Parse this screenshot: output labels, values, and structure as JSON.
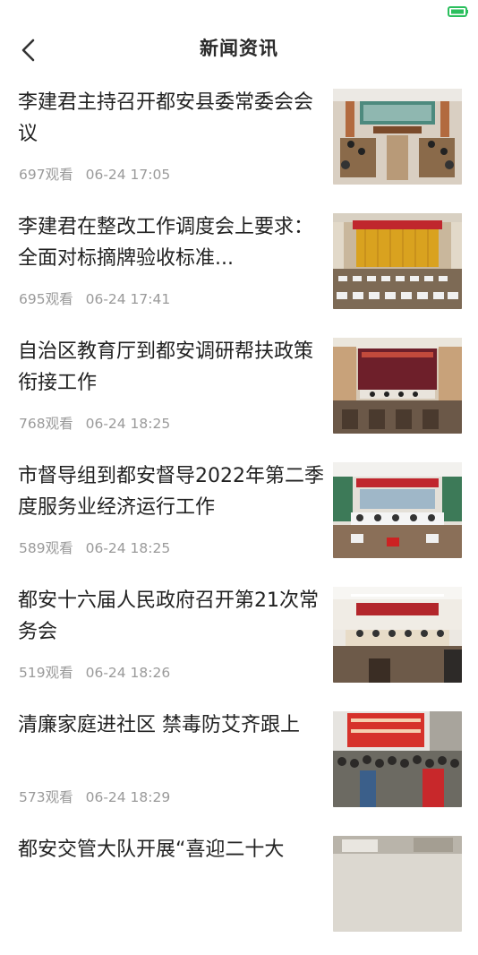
{
  "header": {
    "title": "新闻资讯"
  },
  "icons": {
    "back": "chevron-left-icon",
    "status": "battery-charging-icon"
  },
  "colors": {
    "status_accent": "#2bbf5d",
    "meta_text": "#9a9a9a"
  },
  "news": [
    {
      "title": "李建君主持召开都安县委常委会会议",
      "views": "697观看",
      "time": "06-24 17:05"
    },
    {
      "title": "李建君在整改工作调度会上要求：全面对标摘牌验收标准...",
      "views": "695观看",
      "time": "06-24 17:41"
    },
    {
      "title": "自治区教育厅到都安调研帮扶政策衔接工作",
      "views": "768观看",
      "time": "06-24 18:25"
    },
    {
      "title": "市督导组到都安督导2022年第二季度服务业经济运行工作",
      "views": "589观看",
      "time": "06-24 18:25"
    },
    {
      "title": "都安十六届人民政府召开第21次常务会",
      "views": "519观看",
      "time": "06-24 18:26"
    },
    {
      "title": "清廉家庭进社区 禁毒防艾齐跟上",
      "views": "573观看",
      "time": "06-24 18:29"
    },
    {
      "title": "都安交管大队开展“喜迎二十大",
      "views": "",
      "time": ""
    }
  ]
}
